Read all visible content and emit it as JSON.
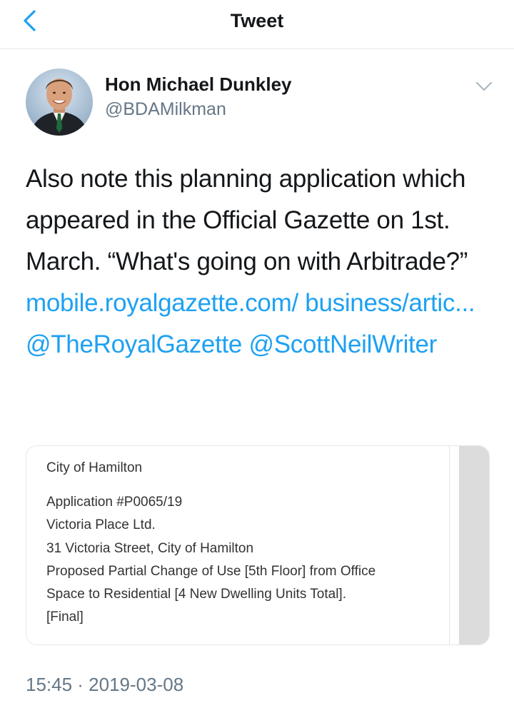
{
  "navbar": {
    "title": "Tweet",
    "back_icon": "chevron-left-icon"
  },
  "author": {
    "display_name": "Hon Michael Dunkley",
    "handle": "@BDAMilkman",
    "menu_icon": "chevron-down-icon"
  },
  "tweet": {
    "text_plain": "Also note this planning application which appeared in the Official Gazette on 1st. March. “What's going on with Arbitrade?” ",
    "link_url": "mobile.royalgazette.com/ business/artic...",
    "mention_1": "@TheRoyalGazette",
    "mention_2": "@ScottNeilWriter",
    "link_color": "#1da1f2"
  },
  "card": {
    "line_1": "City of Hamilton",
    "line_2": "Application #P0065/19",
    "line_3": "Victoria Place Ltd.",
    "line_4": "31 Victoria Street, City of Hamilton",
    "line_5": "Proposed Partial Change of Use [5th Floor] from Office",
    "line_6": "Space to Residential [4 New Dwelling Units Total].",
    "line_7": "[Final]"
  },
  "timestamp": "15:45 · 2019-03-08"
}
